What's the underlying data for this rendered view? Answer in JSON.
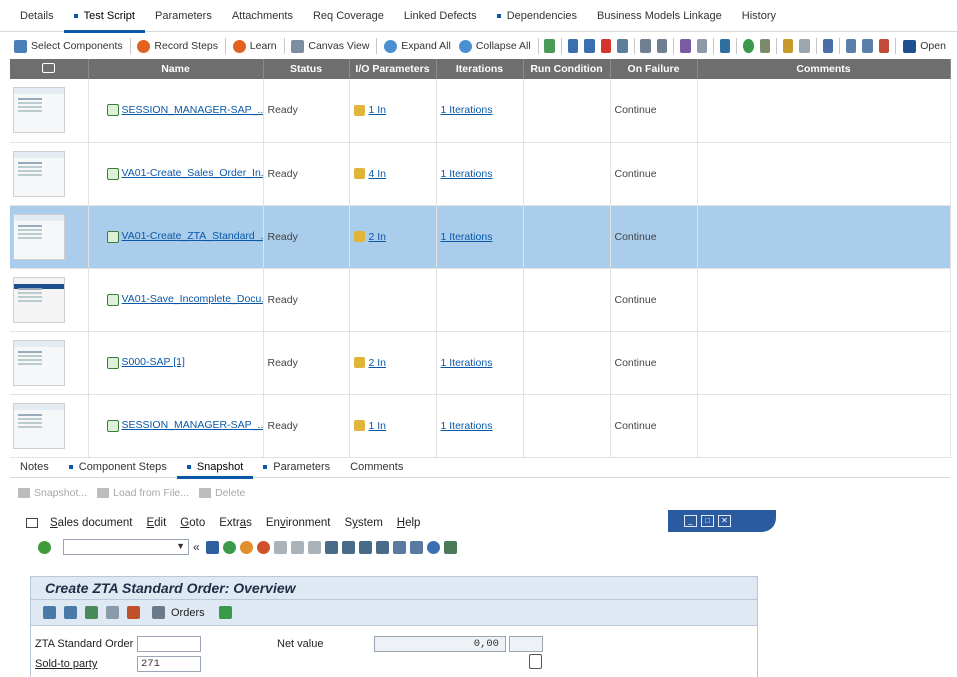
{
  "top_tabs": [
    {
      "label": "Details",
      "active": false,
      "dot": false
    },
    {
      "label": "Test Script",
      "active": true,
      "dot": true
    },
    {
      "label": "Parameters",
      "active": false,
      "dot": false
    },
    {
      "label": "Attachments",
      "active": false,
      "dot": false
    },
    {
      "label": "Req Coverage",
      "active": false,
      "dot": false
    },
    {
      "label": "Linked Defects",
      "active": false,
      "dot": false
    },
    {
      "label": "Dependencies",
      "active": false,
      "dot": true
    },
    {
      "label": "Business Models Linkage",
      "active": false,
      "dot": false
    },
    {
      "label": "History",
      "active": false,
      "dot": false
    }
  ],
  "toolbar": {
    "select_components": "Select Components",
    "record_steps": "Record Steps",
    "learn": "Learn",
    "canvas_view": "Canvas View",
    "expand_all": "Expand All",
    "collapse_all": "Collapse All",
    "open": "Open"
  },
  "grid": {
    "headers": [
      "",
      "Name",
      "Status",
      "I/O Parameters",
      "Iterations",
      "Run Condition",
      "On Failure",
      "Comments"
    ],
    "rows": [
      {
        "name": "SESSION_MANAGER-SAP_...",
        "status": "Ready",
        "io": "1 In",
        "iterations": "1 Iterations",
        "run_condition": "",
        "on_failure": "Continue",
        "comments": "",
        "thumb": "gray"
      },
      {
        "name": "VA01-Create_Sales_Order_In...",
        "status": "Ready",
        "io": "4 In",
        "iterations": "1 Iterations",
        "run_condition": "",
        "on_failure": "Continue",
        "comments": "",
        "thumb": "gray"
      },
      {
        "name": "VA01-Create_ZTA_Standard_...",
        "status": "Ready",
        "io": "2 In",
        "iterations": "1 Iterations",
        "run_condition": "",
        "on_failure": "Continue",
        "comments": "",
        "thumb": "gray",
        "selected": true
      },
      {
        "name": "VA01-Save_Incomplete_Docu...",
        "status": "Ready",
        "io": "",
        "iterations": "",
        "run_condition": "",
        "on_failure": "Continue",
        "comments": "",
        "thumb": "blue"
      },
      {
        "name": "S000-SAP [1]",
        "status": "Ready",
        "io": "2 In",
        "iterations": "1 Iterations",
        "run_condition": "",
        "on_failure": "Continue",
        "comments": "",
        "thumb": "gray"
      },
      {
        "name": "SESSION_MANAGER-SAP_...",
        "status": "Ready",
        "io": "1 In",
        "iterations": "1 Iterations",
        "run_condition": "",
        "on_failure": "Continue",
        "comments": "",
        "thumb": "gray"
      }
    ]
  },
  "bottom_tabs": [
    {
      "label": "Notes",
      "active": false,
      "dot": false
    },
    {
      "label": "Component Steps",
      "active": false,
      "dot": true
    },
    {
      "label": "Snapshot",
      "active": true,
      "dot": true
    },
    {
      "label": "Parameters",
      "active": false,
      "dot": true
    },
    {
      "label": "Comments",
      "active": false,
      "dot": false
    }
  ],
  "sub_toolbar": {
    "snapshot": "Snapshot...",
    "load_from_file": "Load from File...",
    "delete": "Delete"
  },
  "sap": {
    "menu": [
      {
        "pre": "",
        "u": "S",
        "post": "ales document"
      },
      {
        "pre": "",
        "u": "E",
        "post": "dit"
      },
      {
        "pre": "",
        "u": "G",
        "post": "oto"
      },
      {
        "pre": "Extr",
        "u": "a",
        "post": "s"
      },
      {
        "pre": "En",
        "u": "v",
        "post": "ironment"
      },
      {
        "pre": "S",
        "u": "y",
        "post": "stem"
      },
      {
        "pre": "",
        "u": "H",
        "post": "elp"
      }
    ],
    "screen_title": "Create ZTA Standard Order: Overview",
    "orders_button": "Orders",
    "fields": {
      "order_label": "ZTA Standard Order",
      "order_value": "",
      "net_value_label": "Net value",
      "net_value": "0,00",
      "sold_to_label": "Sold-to party",
      "sold_to_value": "271"
    }
  }
}
